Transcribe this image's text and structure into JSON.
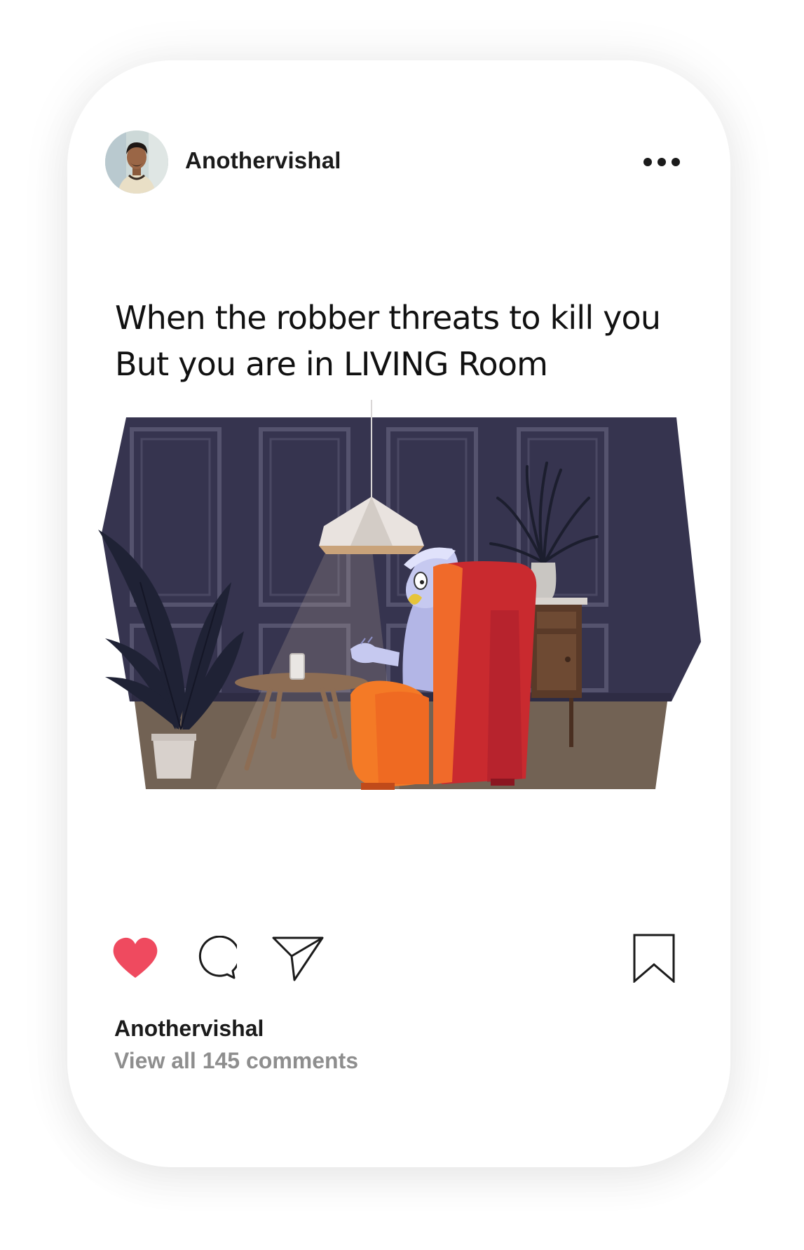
{
  "post": {
    "author": "Anothervishal",
    "caption_lines": [
      "When the robber threats to kill you",
      "But you are in LIVING Room"
    ],
    "liked": true,
    "like_color": "#ef4a5f",
    "liked_by": "Anothervishal",
    "comments_label": "View all 145 comments"
  },
  "icons": {
    "avatar": "user-avatar",
    "more": "more-horizontal-icon",
    "like": "heart-icon",
    "comment": "comment-bubble-icon",
    "share": "paper-plane-icon",
    "save": "bookmark-icon"
  },
  "colors": {
    "text_primary": "#1b1b1b",
    "text_secondary": "#8e8e8e",
    "wall": "#36344f",
    "chair": "#e8452b"
  }
}
